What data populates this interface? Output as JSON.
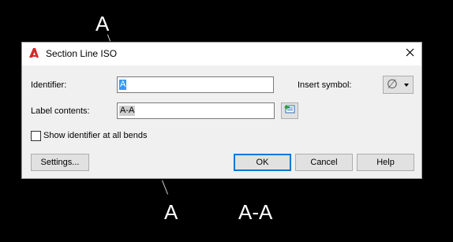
{
  "background": {
    "label_a_top": "A",
    "label_a_bottom": "A",
    "label_aa_bottom": "A-A"
  },
  "dialog": {
    "title": "Section Line ISO",
    "app_icon": "autocad-logo-icon",
    "close_icon": "close-icon",
    "identifier": {
      "label": "Identifier:",
      "value": "A"
    },
    "label_contents": {
      "label": "Label contents:",
      "value": "A-A",
      "field_button_icon": "insert-field-icon"
    },
    "insert_symbol": {
      "label": "Insert symbol:",
      "value": "∅",
      "icon": "chevron-down-icon"
    },
    "show_identifier": {
      "label": "Show identifier at all bends",
      "checked": false
    },
    "buttons": {
      "settings": "Settings...",
      "ok": "OK",
      "cancel": "Cancel",
      "help": "Help"
    }
  },
  "colors": {
    "brand_red": "#d22a2a",
    "selection": "#3399ff",
    "default_button_border": "#0078d7"
  }
}
